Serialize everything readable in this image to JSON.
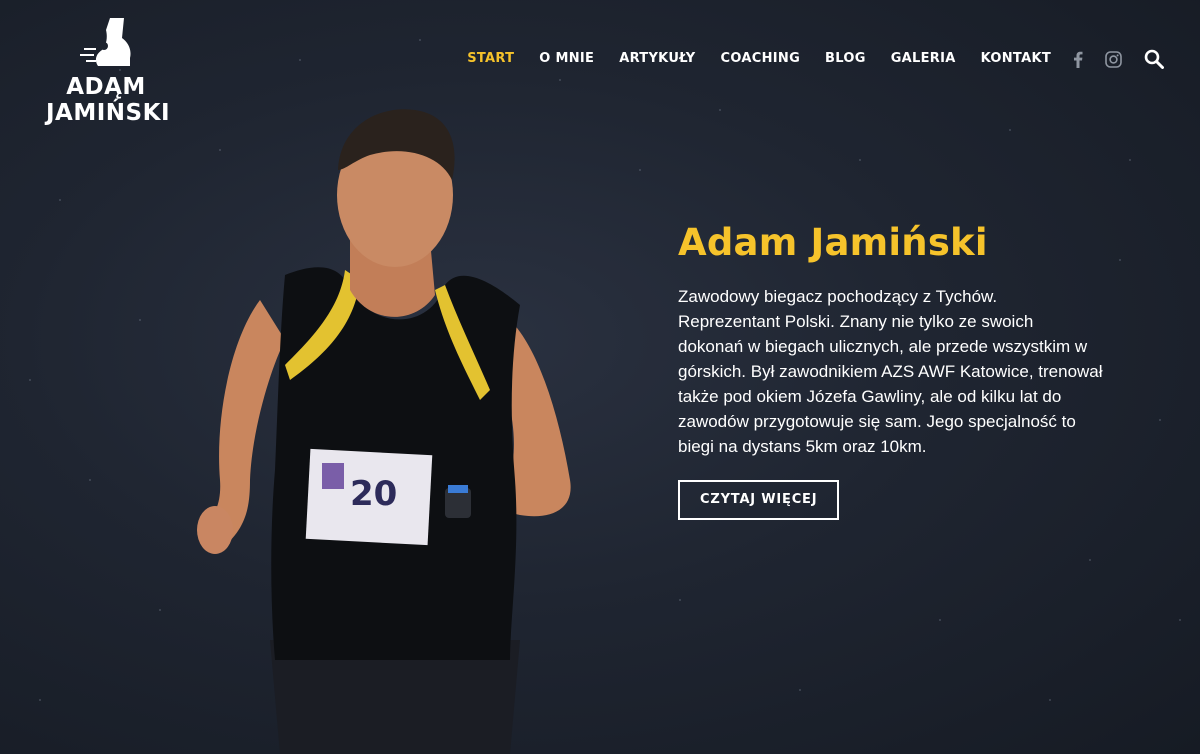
{
  "brand": {
    "line1": "ADĄM",
    "line2": "JAMIŃSKI",
    "logo_icon": "running-foot-icon"
  },
  "nav": {
    "items": [
      {
        "label": "START",
        "active": true
      },
      {
        "label": "O MNIE",
        "active": false
      },
      {
        "label": "ARTYKUŁY",
        "active": false
      },
      {
        "label": "COACHING",
        "active": false
      },
      {
        "label": "BLOG",
        "active": false
      },
      {
        "label": "GALERIA",
        "active": false
      },
      {
        "label": "KONTAKT",
        "active": false
      }
    ],
    "icons": [
      "facebook-icon",
      "instagram-icon",
      "search-icon"
    ]
  },
  "hero": {
    "title": "Adam Jamiński",
    "description": "Zawodowy biegacz pochodzący z Tychów. Reprezentant Polski. Znany nie tylko ze swoich dokonań w biegach ulicznych, ale przede wszystkim w górskich. Był zawodnikiem AZS AWF Katowice, trenował także pod okiem Józefa Gawliny, ale od kilku lat do zawodów przygotowuje się sam. Jego specjalność to biegi na dystans 5km oraz 10km.",
    "cta_label": "CZYTAJ WIĘCEJ",
    "bib_number": "20"
  },
  "colors": {
    "accent": "#f6c32b",
    "background": "#1c222d",
    "text": "#ffffff"
  }
}
